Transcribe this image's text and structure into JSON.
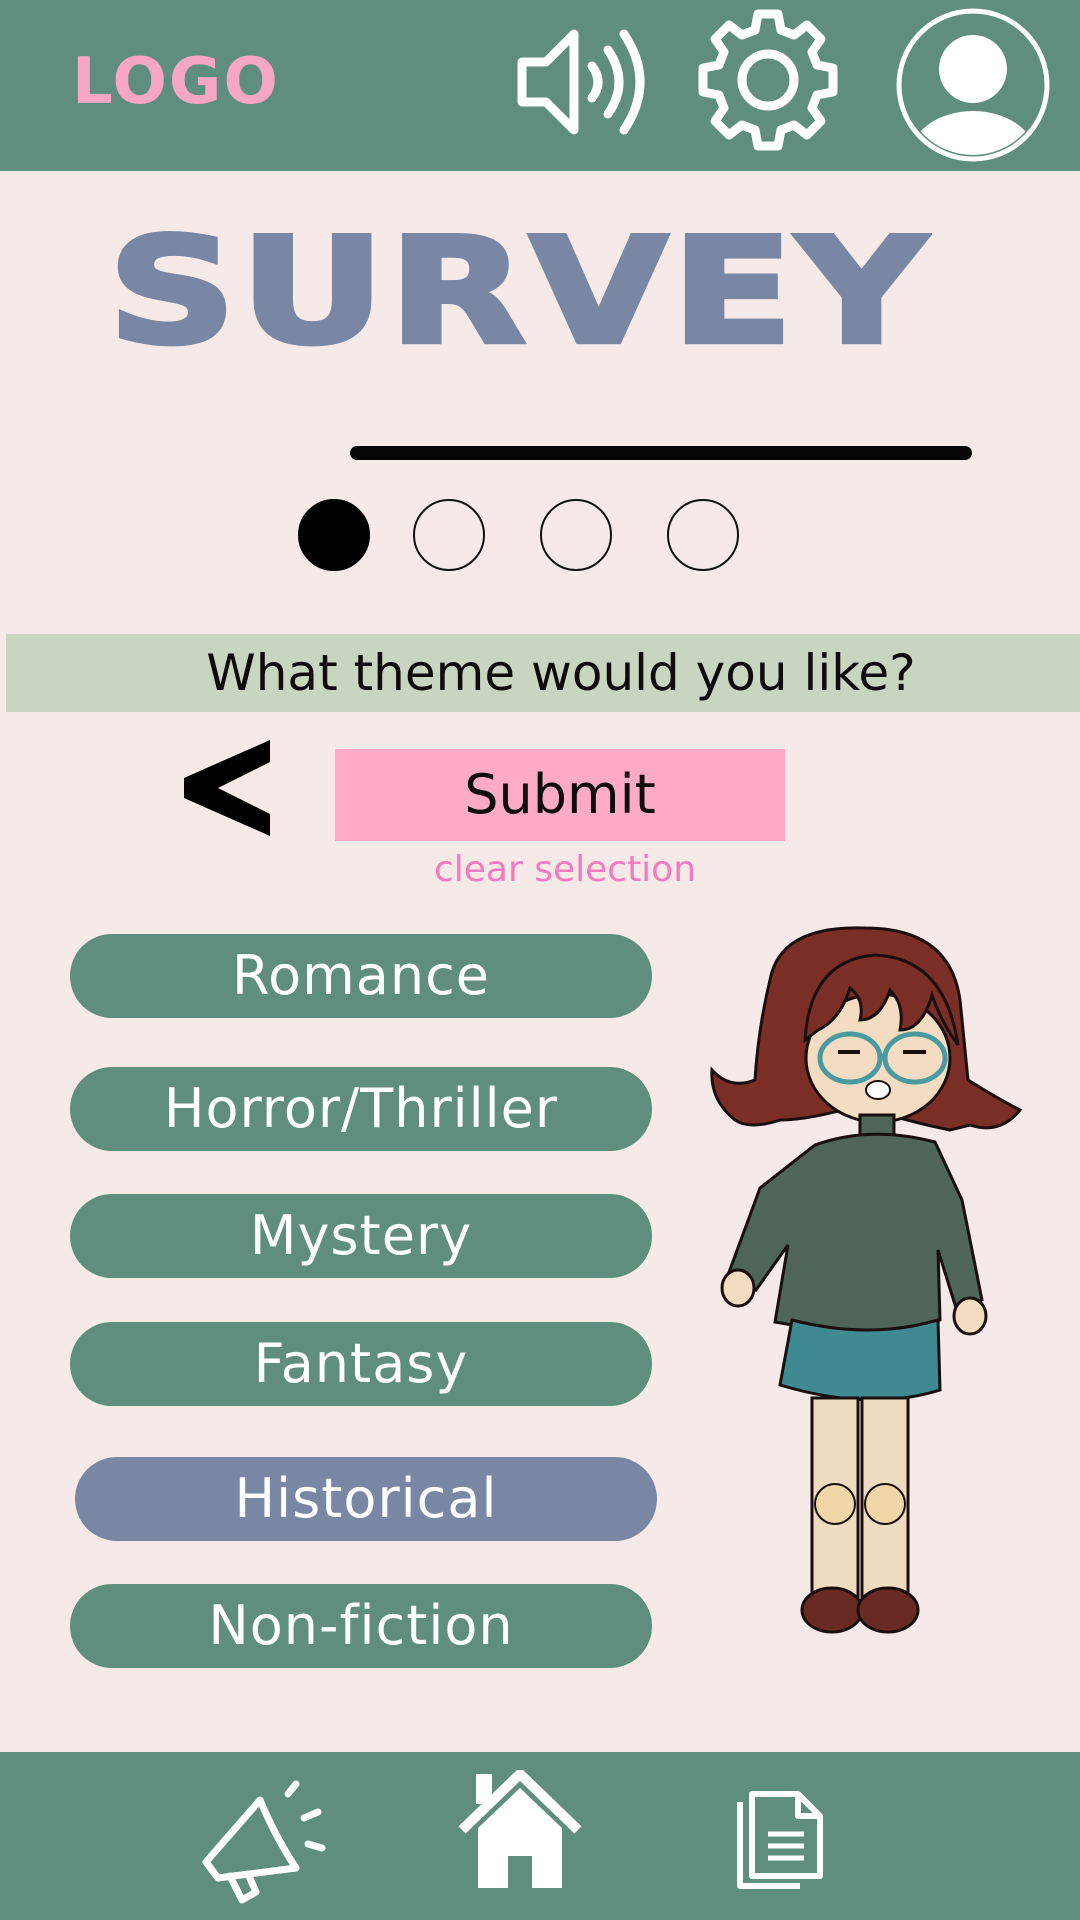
{
  "header": {
    "logo": "LOGO",
    "icons": [
      "speaker-icon",
      "gear-icon",
      "profile-icon"
    ]
  },
  "survey": {
    "title": "SURVEY",
    "progress": {
      "total_steps": 4,
      "current_step": 1
    }
  },
  "question": {
    "text": "What theme would you like?"
  },
  "actions": {
    "back_icon": "chevron-left-icon",
    "submit_label": "Submit",
    "clear_label": "clear selection"
  },
  "options": [
    {
      "label": "Romance",
      "selected": false
    },
    {
      "label": "Horror/Thriller",
      "selected": false
    },
    {
      "label": "Mystery",
      "selected": false
    },
    {
      "label": "Fantasy",
      "selected": false
    },
    {
      "label": "Historical",
      "selected": true
    },
    {
      "label": "Non-fiction",
      "selected": false
    }
  ],
  "bottom_nav": {
    "items": [
      "megaphone-icon",
      "home-icon",
      "document-icon"
    ]
  },
  "colors": {
    "bar_green": "#5f8e7e",
    "background": "#f5eae7",
    "accent_blue": "#7987a5",
    "logo_pink": "#f7a7c4",
    "submit_pink": "#ffaac7",
    "clear_pink": "#f57ac0",
    "question_bar": "#c8d5c0"
  }
}
